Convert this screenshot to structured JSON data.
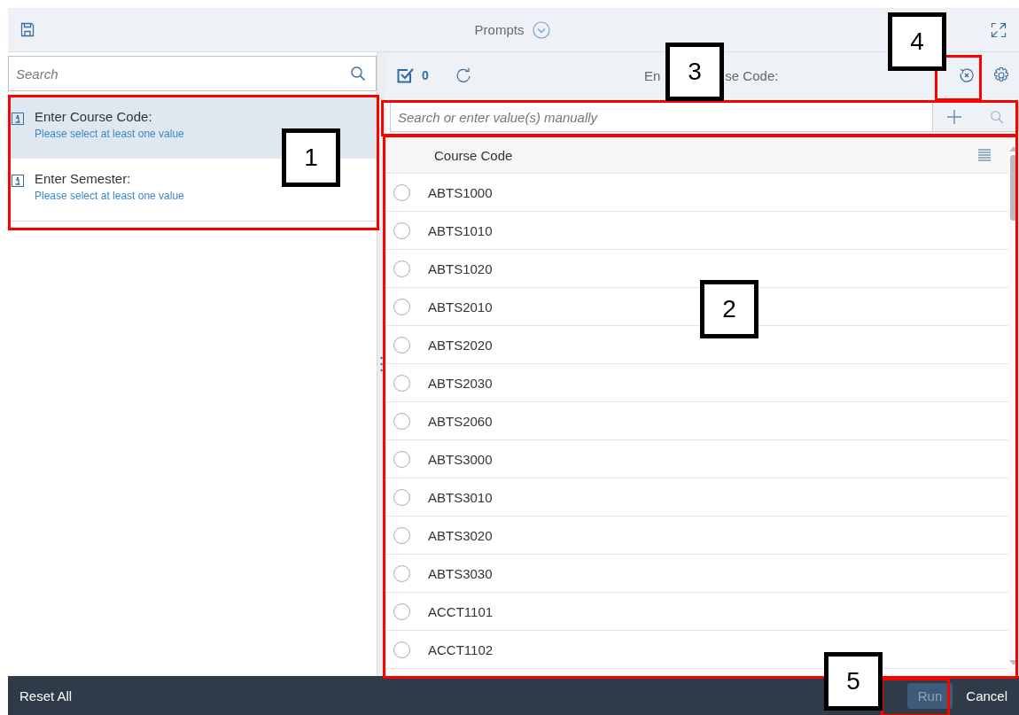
{
  "header": {
    "title": "Prompts"
  },
  "sidebar": {
    "search": {
      "placeholder": "Search"
    },
    "items": [
      {
        "title": "Enter Course Code:",
        "hint": "Please select at least one value",
        "selected": true
      },
      {
        "title": "Enter Semester:",
        "hint": "Please select at least one value",
        "selected": false
      }
    ]
  },
  "toolbar": {
    "selected_count": "0",
    "title_parts": [
      "En",
      "se Code:"
    ]
  },
  "value_search": {
    "placeholder": "Search or enter value(s) manually"
  },
  "table": {
    "columns": [
      "Course Code"
    ],
    "rows": [
      {
        "value": "ABTS1000",
        "selected": false
      },
      {
        "value": "ABTS1010",
        "selected": false
      },
      {
        "value": "ABTS1020",
        "selected": false
      },
      {
        "value": "ABTS2010",
        "selected": false
      },
      {
        "value": "ABTS2020",
        "selected": false
      },
      {
        "value": "ABTS2030",
        "selected": false
      },
      {
        "value": "ABTS2060",
        "selected": false
      },
      {
        "value": "ABTS3000",
        "selected": false
      },
      {
        "value": "ABTS3010",
        "selected": false
      },
      {
        "value": "ABTS3020",
        "selected": false
      },
      {
        "value": "ABTS3030",
        "selected": false
      },
      {
        "value": "ACCT1101",
        "selected": false
      },
      {
        "value": "ACCT1102",
        "selected": false
      }
    ]
  },
  "footer": {
    "reset": "Reset All",
    "run": {
      "label": "Run",
      "disabled": true
    },
    "cancel": "Cancel"
  },
  "annotations": [
    {
      "label": "1"
    },
    {
      "label": "2"
    },
    {
      "label": "3"
    },
    {
      "label": "4"
    },
    {
      "label": "5"
    }
  ]
}
